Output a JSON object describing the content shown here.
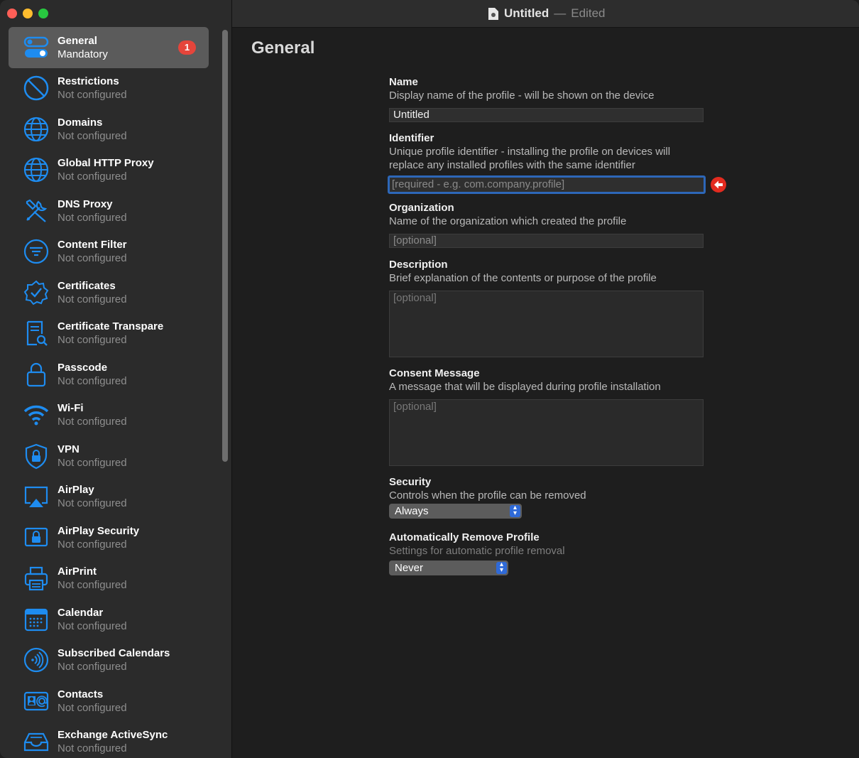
{
  "window": {
    "title": "Untitled",
    "separator": "—",
    "status": "Edited"
  },
  "sidebar": {
    "items": [
      {
        "title": "General",
        "subtitle": "Mandatory",
        "badge": "1",
        "icon": "toggles-icon"
      },
      {
        "title": "Restrictions",
        "subtitle": "Not configured",
        "icon": "prohibited-icon"
      },
      {
        "title": "Domains",
        "subtitle": "Not configured",
        "icon": "globe-icon"
      },
      {
        "title": "Global HTTP Proxy",
        "subtitle": "Not configured",
        "icon": "globe-network-icon"
      },
      {
        "title": "DNS Proxy",
        "subtitle": "Not configured",
        "icon": "tools-icon"
      },
      {
        "title": "Content Filter",
        "subtitle": "Not configured",
        "icon": "filter-icon"
      },
      {
        "title": "Certificates",
        "subtitle": "Not configured",
        "icon": "checkmark-seal-icon"
      },
      {
        "title": "Certificate Transpare",
        "subtitle": "Not configured",
        "icon": "doc-magnifier-icon"
      },
      {
        "title": "Passcode",
        "subtitle": "Not configured",
        "icon": "lock-icon"
      },
      {
        "title": "Wi-Fi",
        "subtitle": "Not configured",
        "icon": "wifi-icon"
      },
      {
        "title": "VPN",
        "subtitle": "Not configured",
        "icon": "lock-shield-icon"
      },
      {
        "title": "AirPlay",
        "subtitle": "Not configured",
        "icon": "airplay-icon"
      },
      {
        "title": "AirPlay Security",
        "subtitle": "Not configured",
        "icon": "airplay-lock-icon"
      },
      {
        "title": "AirPrint",
        "subtitle": "Not configured",
        "icon": "printer-icon"
      },
      {
        "title": "Calendar",
        "subtitle": "Not configured",
        "icon": "calendar-icon"
      },
      {
        "title": "Subscribed Calendars",
        "subtitle": "Not configured",
        "icon": "broadcast-icon"
      },
      {
        "title": "Contacts",
        "subtitle": "Not configured",
        "icon": "contact-card-icon"
      },
      {
        "title": "Exchange ActiveSync",
        "subtitle": "Not configured",
        "icon": "tray-icon"
      }
    ]
  },
  "main": {
    "title": "General",
    "name": {
      "label": "Name",
      "description": "Display name of the profile - will be shown on the device",
      "value": "Untitled"
    },
    "identifier": {
      "label": "Identifier",
      "description_line1": "Unique profile identifier - installing the profile on devices will",
      "description_line2": "replace any installed profiles with the same identifier",
      "placeholder": "[required - e.g. com.company.profile]"
    },
    "organization": {
      "label": "Organization",
      "description": "Name of the organization which created the profile",
      "placeholder": "[optional]"
    },
    "description": {
      "label": "Description",
      "description": "Brief explanation of the contents or purpose of the profile",
      "placeholder": "[optional]"
    },
    "consent": {
      "label": "Consent Message",
      "description": "A message that will be displayed during profile installation",
      "placeholder": "[optional]"
    },
    "security": {
      "label": "Security",
      "description": "Controls when the profile can be removed",
      "selected": "Always"
    },
    "auto_remove": {
      "label": "Automatically Remove Profile",
      "description": "Settings for automatic profile removal",
      "selected": "Never"
    }
  },
  "colors": {
    "accent": "#1e8cf0",
    "badge": "#e5453b",
    "error": "#e32b1f",
    "focus": "#2d67b8"
  }
}
